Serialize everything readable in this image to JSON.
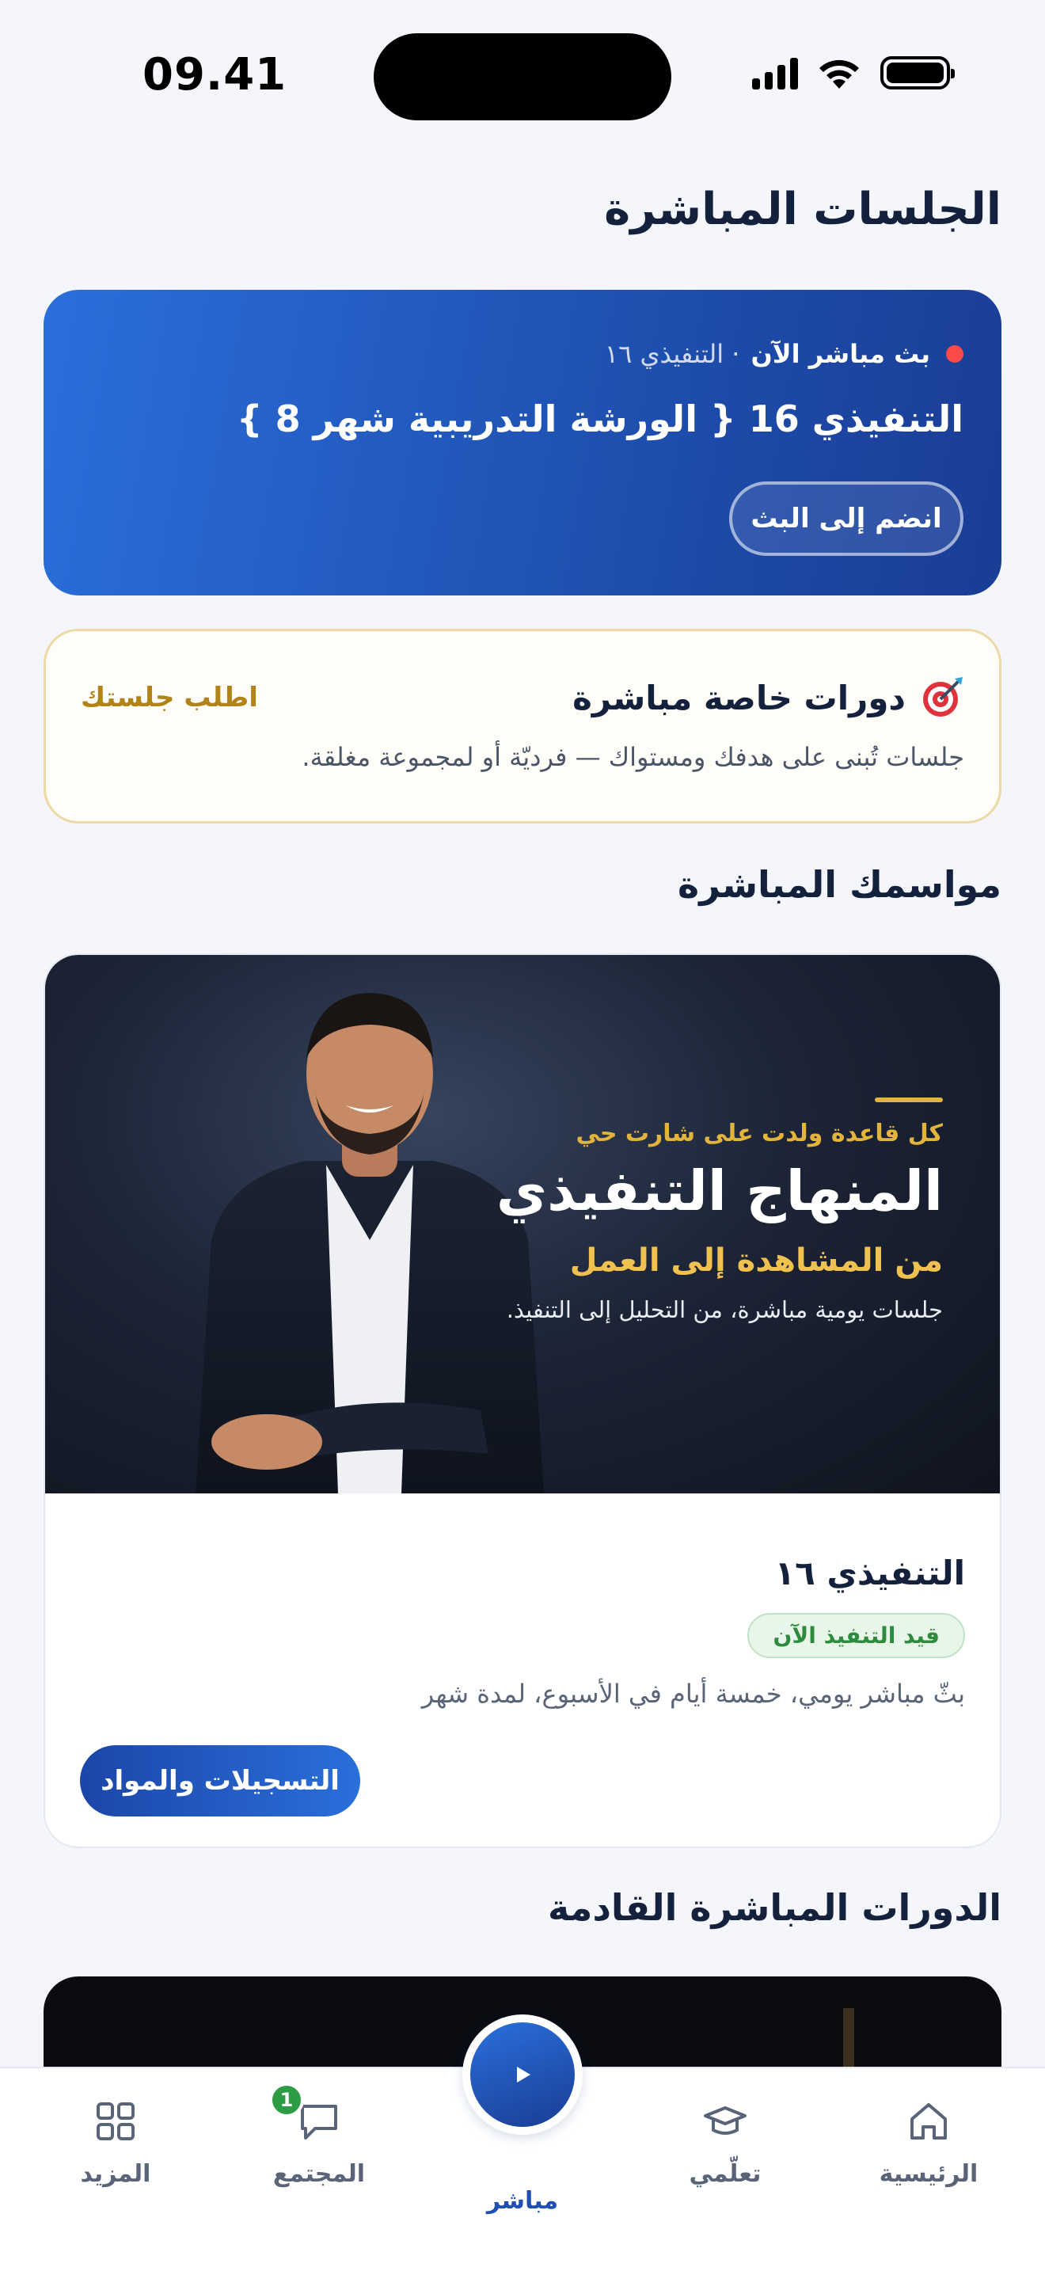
{
  "status_bar": {
    "time": "09.41"
  },
  "page_title": "الجلسات المباشرة",
  "live_now": {
    "label": "بث مباشر الآن",
    "sub": "· التنفيذي ١٦",
    "title": "التنفيذي 16 { الورشة التدريبية شهر 8 }",
    "join_label": "انضم إلى البث",
    "accent": "#ff4a4a"
  },
  "private_courses": {
    "icon": "target-icon",
    "title": "دورات خاصة مباشرة",
    "link_label": "اطلب جلستك",
    "description": "جلسات تُبنى على هدفك ومستواك — فرديّة أو لمجموعة مغلقة."
  },
  "seasons": {
    "section_title": "مواسمك المباشرة",
    "banner": {
      "kicker": "كل قاعدة ولدت على شارت حي",
      "title": "المنهاج التنفيذي",
      "subtitle": "من المشاهدة إلى العمل",
      "note": "جلسات يومية مباشرة، من التحليل إلى التنفيذ."
    },
    "name": "التنفيذي ١٦",
    "status": "قيد التنفيذ الآن",
    "description": "بثّ مباشر يومي، خمسة أيام في الأسبوع، لمدة شهر",
    "recordings_label": "التسجيلات والمواد"
  },
  "upcoming": {
    "section_title": "الدورات المباشرة القادمة"
  },
  "tab_bar": {
    "home": "الرئيسية",
    "learn": "تعلّمي",
    "live": "مباشر",
    "community": "المجتمع",
    "community_badge": "1",
    "more": "المزيد",
    "active_color": "#1f4fb4"
  }
}
